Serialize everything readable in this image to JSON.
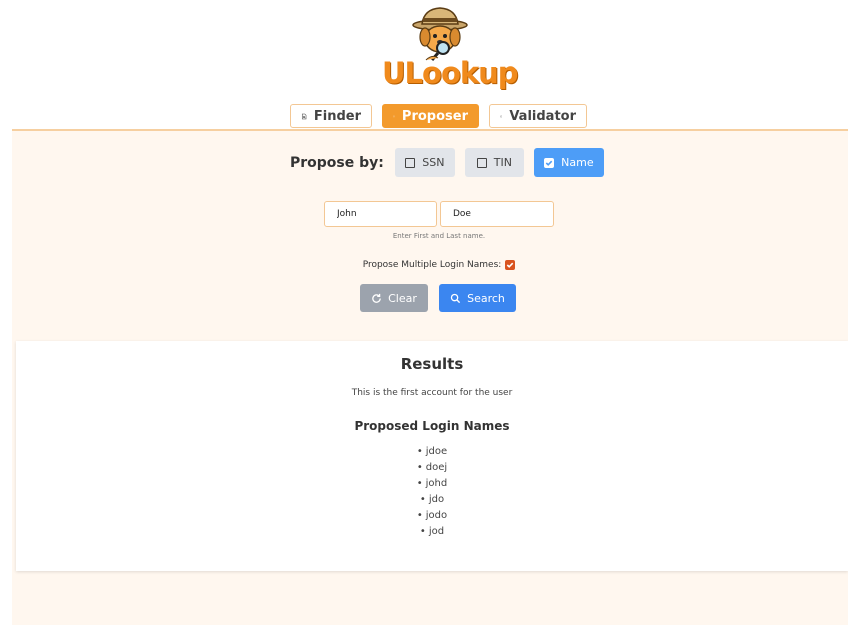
{
  "app": {
    "logo_text": "ULookup"
  },
  "tabs": [
    {
      "label": "Finder",
      "icon": "search-file-icon",
      "active": false
    },
    {
      "label": "Proposer",
      "icon": "lightbulb-icon",
      "active": true
    },
    {
      "label": "Validator",
      "icon": "badge-check-icon",
      "active": false
    }
  ],
  "proposer": {
    "propose_by_label": "Propose by:",
    "options": [
      {
        "label": "SSN",
        "checked": false
      },
      {
        "label": "TIN",
        "checked": false
      },
      {
        "label": "Name",
        "checked": true
      }
    ],
    "first_name": {
      "value": "John"
    },
    "last_name": {
      "value": "Doe"
    },
    "hint": "Enter First and Last name.",
    "multiple_label": "Propose Multiple Login Names:",
    "multiple_checked": true,
    "clear_label": "Clear",
    "search_label": "Search"
  },
  "results": {
    "title": "Results",
    "note": "This is the first account for the user",
    "subtitle": "Proposed Login Names",
    "names": [
      "jdoe",
      "doej",
      "johd",
      "jdo",
      "jodo",
      "jod"
    ]
  },
  "colors": {
    "accent": "#f39a2c",
    "panel_bg": "#fff7ef",
    "primary_blue": "#3b86f0",
    "checkbox_orange": "#d9531e"
  }
}
